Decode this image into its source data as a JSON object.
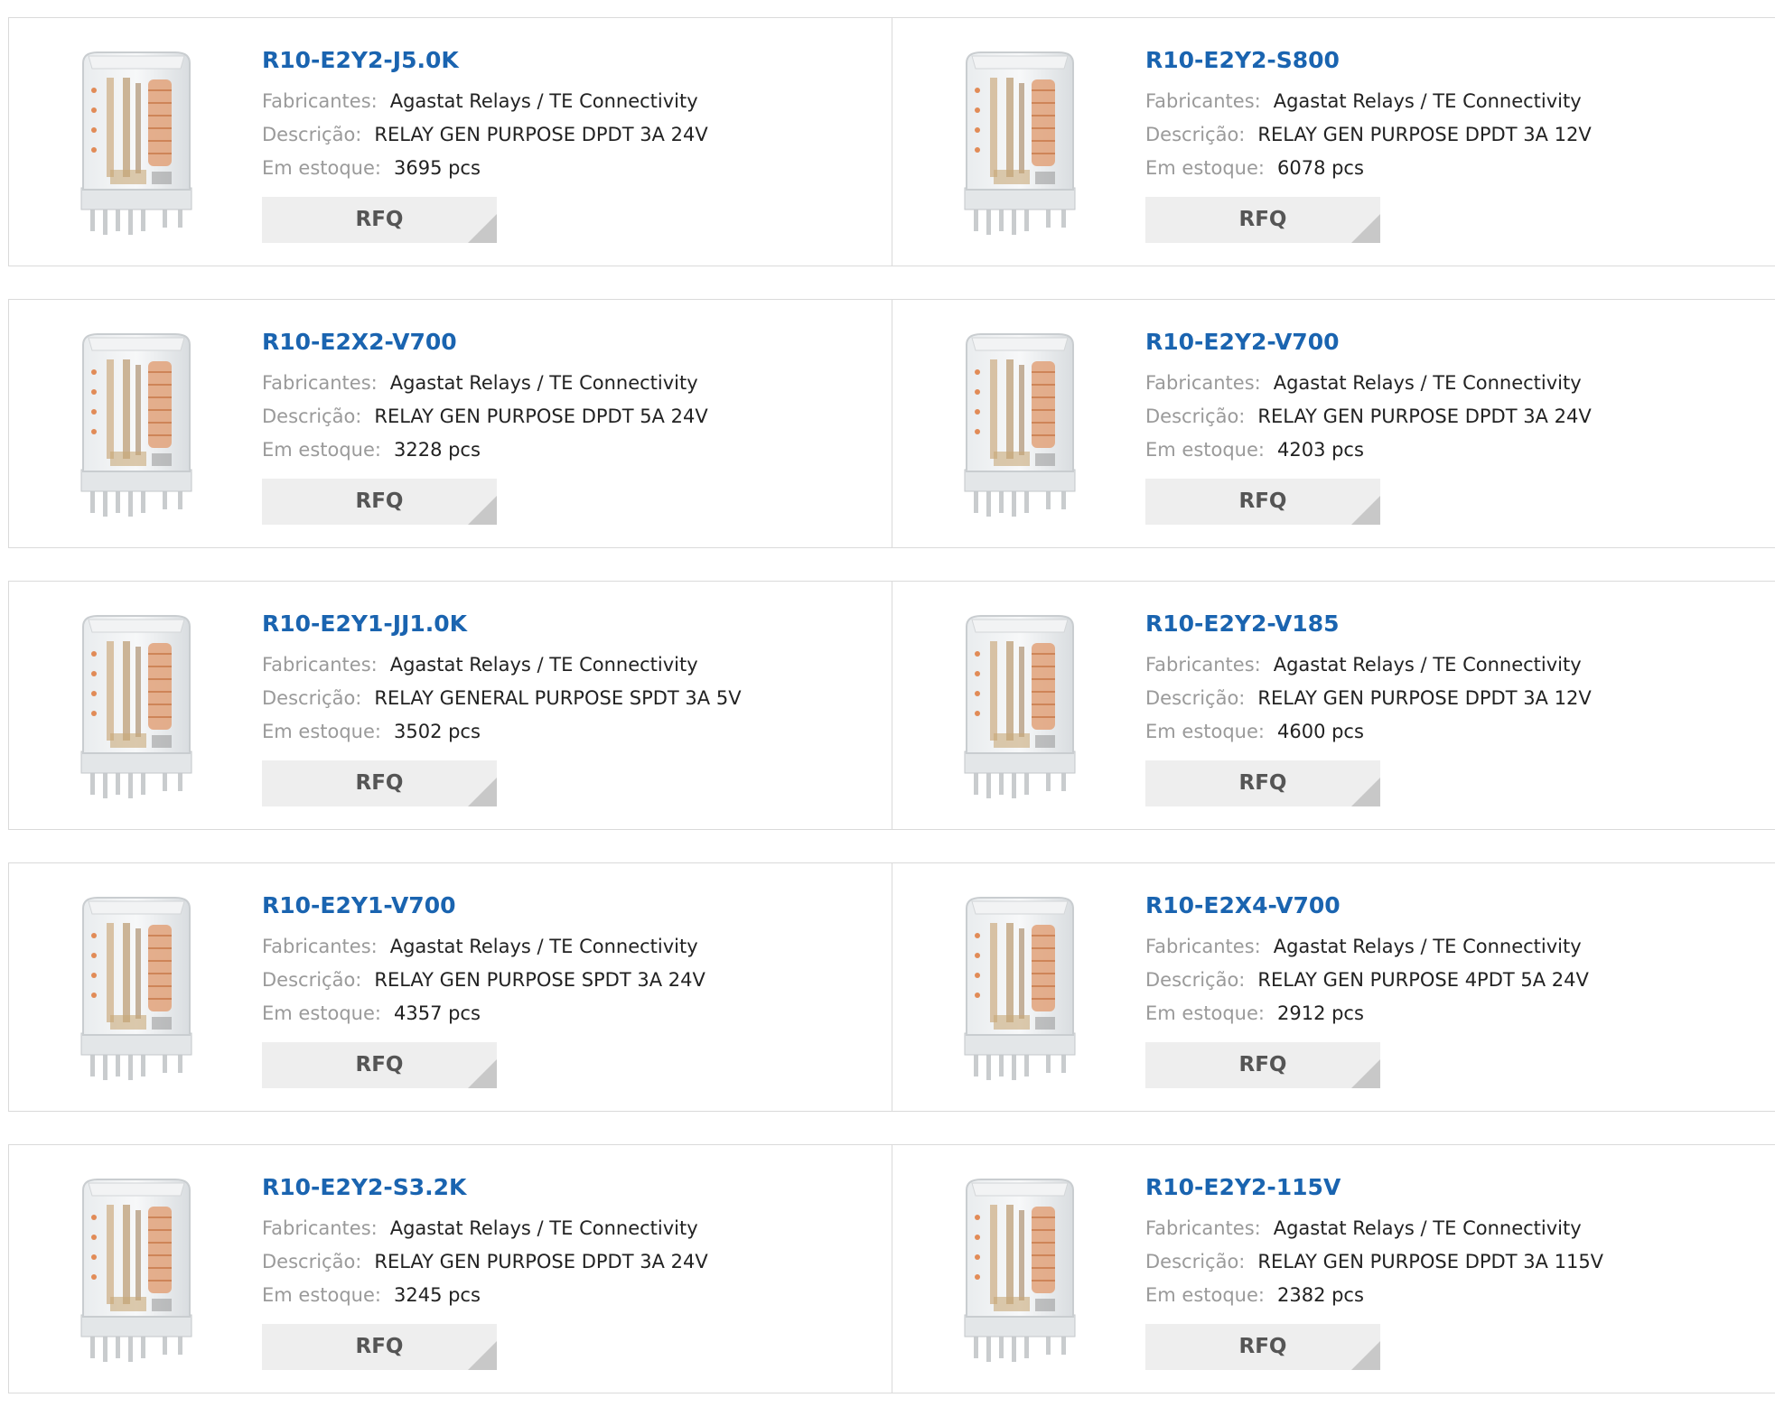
{
  "labels": {
    "manufacturer": "Fabricantes:",
    "description": "Descrição:",
    "stock": "Em estoque:",
    "rfq": "RFQ"
  },
  "icons": {
    "product": "relay-product-image"
  },
  "colors": {
    "part_number": "#1a64b0",
    "label": "#9a9a9a",
    "rfq_bg": "#eeeeee",
    "rfq_corner": "#c8c8c8",
    "border": "#dadada"
  },
  "products": [
    {
      "part": "R10-E2Y2-J5.0K",
      "manufacturer": "Agastat Relays / TE Connectivity",
      "description": "RELAY GEN PURPOSE DPDT 3A 24V",
      "stock": "3695 pcs"
    },
    {
      "part": "R10-E2Y2-S800",
      "manufacturer": "Agastat Relays / TE Connectivity",
      "description": "RELAY GEN PURPOSE DPDT 3A 12V",
      "stock": "6078 pcs"
    },
    {
      "part": "R10-E2X2-V700",
      "manufacturer": "Agastat Relays / TE Connectivity",
      "description": "RELAY GEN PURPOSE DPDT 5A 24V",
      "stock": "3228 pcs"
    },
    {
      "part": "R10-E2Y2-V700",
      "manufacturer": "Agastat Relays / TE Connectivity",
      "description": "RELAY GEN PURPOSE DPDT 3A 24V",
      "stock": "4203 pcs"
    },
    {
      "part": "R10-E2Y1-JJ1.0K",
      "manufacturer": "Agastat Relays / TE Connectivity",
      "description": "RELAY GENERAL PURPOSE SPDT 3A 5V",
      "stock": "3502 pcs"
    },
    {
      "part": "R10-E2Y2-V185",
      "manufacturer": "Agastat Relays / TE Connectivity",
      "description": "RELAY GEN PURPOSE DPDT 3A 12V",
      "stock": "4600 pcs"
    },
    {
      "part": "R10-E2Y1-V700",
      "manufacturer": "Agastat Relays / TE Connectivity",
      "description": "RELAY GEN PURPOSE SPDT 3A 24V",
      "stock": "4357 pcs"
    },
    {
      "part": "R10-E2X4-V700",
      "manufacturer": "Agastat Relays / TE Connectivity",
      "description": "RELAY GEN PURPOSE 4PDT 5A 24V",
      "stock": "2912 pcs"
    },
    {
      "part": "R10-E2Y2-S3.2K",
      "manufacturer": "Agastat Relays / TE Connectivity",
      "description": "RELAY GEN PURPOSE DPDT 3A 24V",
      "stock": "3245 pcs"
    },
    {
      "part": "R10-E2Y2-115V",
      "manufacturer": "Agastat Relays / TE Connectivity",
      "description": "RELAY GEN PURPOSE DPDT 3A 115V",
      "stock": "2382 pcs"
    }
  ]
}
